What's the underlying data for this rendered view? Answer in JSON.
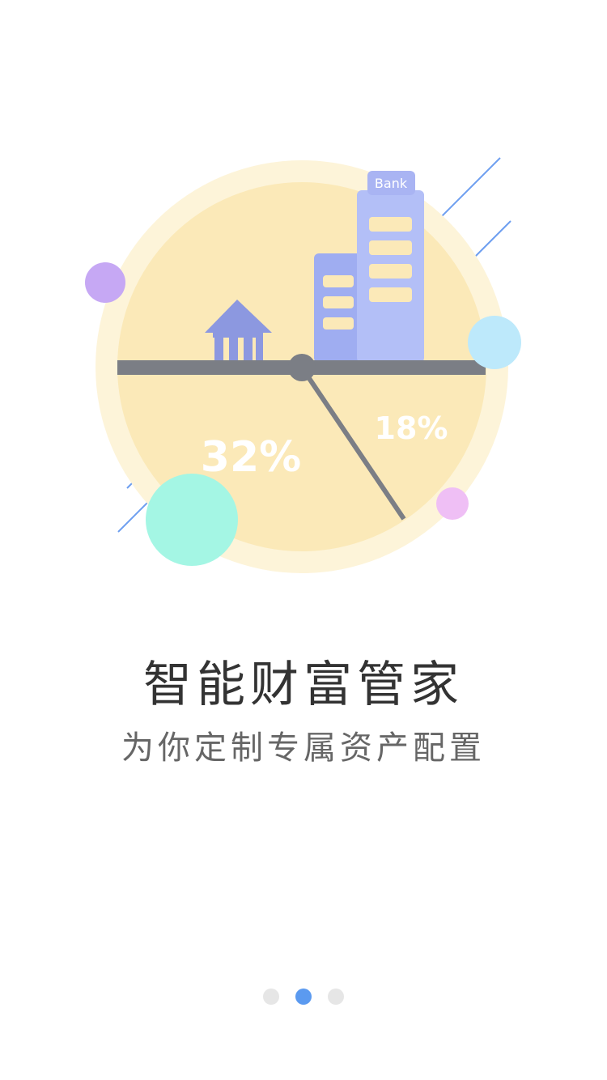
{
  "illustration": {
    "bank_label": "Bank",
    "left_percent": "32%",
    "right_percent": "18%"
  },
  "onboarding": {
    "title": "智能财富管家",
    "subtitle": "为你定制专属资产配置"
  },
  "pager": {
    "count": 3,
    "active_index": 1,
    "active_color": "#5b9af0",
    "inactive_color": "#e6e6e6"
  },
  "colors": {
    "pie_fill": "#fbe9b8",
    "pie_ring": "#fdf4d9",
    "buildings": "#a9b4f3",
    "bar": "#7b7e85"
  }
}
